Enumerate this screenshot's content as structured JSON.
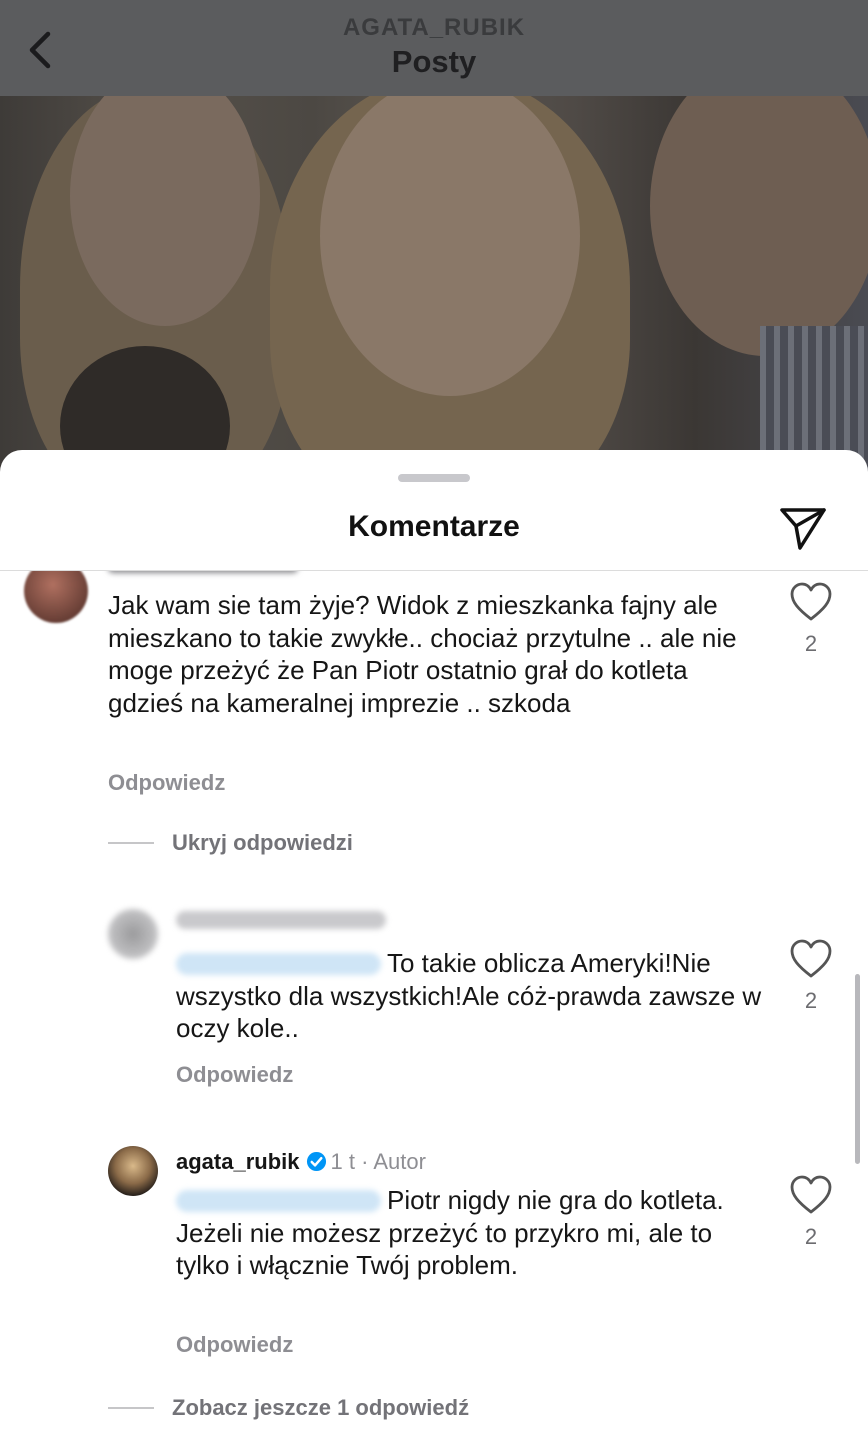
{
  "header": {
    "username": "AGATA_RUBIK",
    "title": "Posty"
  },
  "sheet": {
    "title": "Komentarze"
  },
  "comments": [
    {
      "text": "Jak wam sie tam żyje? Widok z mieszkanka fajny ale mieszkano to takie zwykłe.. chociaż przytulne .. ale nie moge przeżyć że Pan Piotr ostatnio grał do kotleta gdzieś na kameralnej imprezie .. szkoda",
      "reply_label": "Odpowiedz",
      "likes": "2"
    }
  ],
  "thread_hide": "Ukryj odpowiedzi",
  "replies": [
    {
      "text": "To takie oblicza Ameryki!Nie wszystko dla wszystkich!Ale cóż-prawda zawsze w oczy kole..",
      "reply_label": "Odpowiedz",
      "likes": "2"
    },
    {
      "username": "agata_rubik",
      "time": "1 t",
      "separator": "·",
      "author_badge": "Autor",
      "text": "Piotr nigdy nie gra do kotleta. Jeżeli nie możesz przeżyć to przykro mi, ale to tylko i włącznie Twój problem.",
      "reply_label": "Odpowiedz",
      "likes": "2"
    }
  ],
  "thread_more": "Zobacz jeszcze 1 odpowiedź",
  "icons": {
    "back": "chevron-left-icon",
    "send": "paper-plane-icon",
    "like": "heart-outline-icon",
    "verified": "verified-badge-icon"
  },
  "colors": {
    "verified": "#0095f6",
    "muted_text": "#8e8e93",
    "mention_highlight": "#cfe5f6"
  }
}
